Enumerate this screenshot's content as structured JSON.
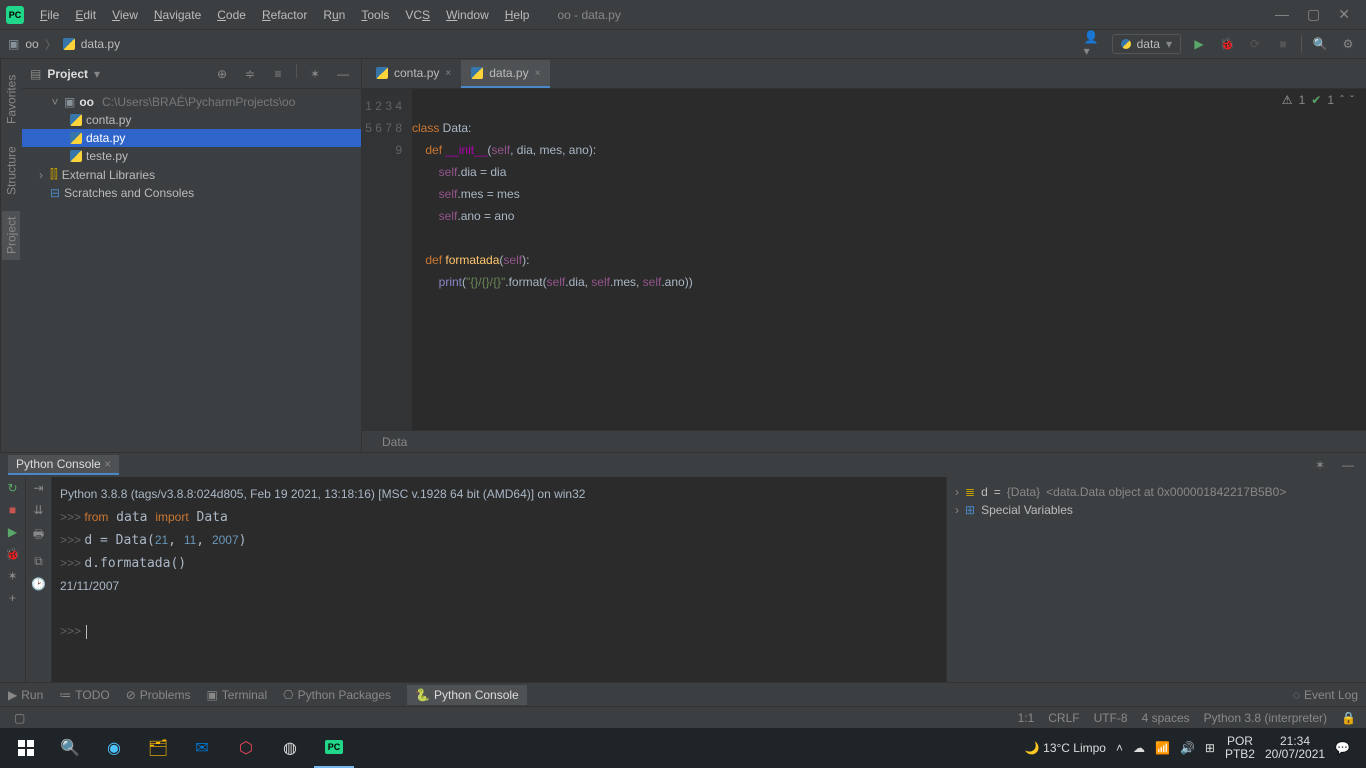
{
  "window": {
    "title": "oo - data.py"
  },
  "menu": [
    "File",
    "Edit",
    "View",
    "Navigate",
    "Code",
    "Refactor",
    "Run",
    "Tools",
    "VCS",
    "Window",
    "Help"
  ],
  "breadcrumb": {
    "root": "oo",
    "file": "data.py"
  },
  "run_config": {
    "name": "data"
  },
  "project": {
    "panel_title": "Project",
    "root": {
      "name": "oo",
      "path": "C:\\Users\\BRAÉ\\PycharmProjects\\oo"
    },
    "files": [
      "conta.py",
      "data.py",
      "teste.py"
    ],
    "external": "External Libraries",
    "scratches": "Scratches and Consoles"
  },
  "tabs": [
    {
      "name": "conta.py",
      "active": false
    },
    {
      "name": "data.py",
      "active": true
    }
  ],
  "editor": {
    "lines": [
      1,
      2,
      3,
      4,
      5,
      6,
      7,
      8,
      9
    ],
    "inspections": {
      "warn": "1",
      "ok": "1"
    },
    "breadcrumb": "Data"
  },
  "console": {
    "tab": "Python Console",
    "header": "Python 3.8.8 (tags/v3.8.8:024d805, Feb 19 2021, 13:18:16) [MSC v.1928 64 bit (AMD64)] on win32",
    "output": "21/11/2007",
    "vars": {
      "d_name": "d",
      "d_type": "{Data}",
      "d_repr": "<data.Data object at 0x000001842217B5B0>",
      "special": "Special Variables"
    }
  },
  "bottom_tabs": {
    "run": "Run",
    "todo": "TODO",
    "problems": "Problems",
    "terminal": "Terminal",
    "packages": "Python Packages",
    "console": "Python Console",
    "eventlog": "Event Log"
  },
  "status": {
    "pos": "1:1",
    "sep": "CRLF",
    "enc": "UTF-8",
    "indent": "4 spaces",
    "interp": "Python 3.8 (interpreter)"
  },
  "taskbar": {
    "weather": "13°C  Limpo",
    "lang": "POR",
    "kb": "PTB2",
    "time": "21:34",
    "date": "20/07/2021"
  },
  "left_tabs": {
    "project": "Project",
    "structure": "Structure",
    "favorites": "Favorites"
  }
}
